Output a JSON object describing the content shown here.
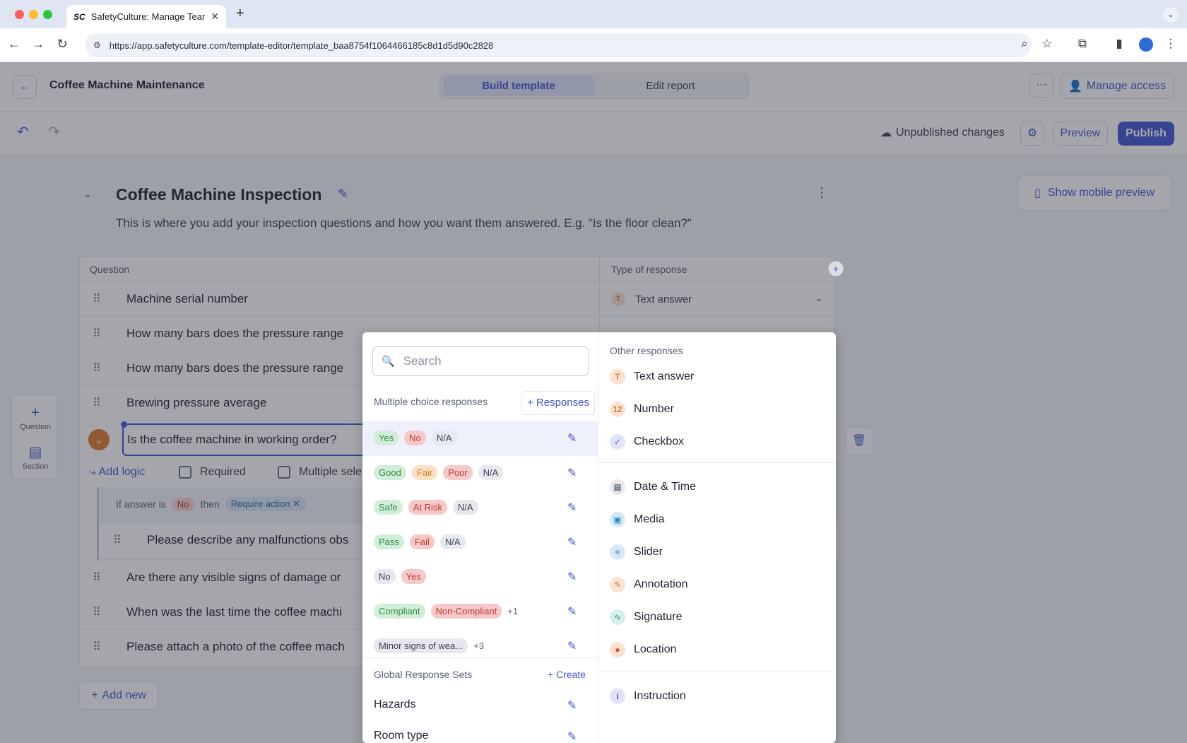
{
  "browser": {
    "tab_title": "SafetyCulture: Manage Teams and...",
    "favicon": "SC",
    "url": "https://app.safetyculture.com/template-editor/template_baa8754f1064466185c8d1d5d90c2828"
  },
  "header": {
    "title": "Coffee Machine Maintenance",
    "mode_build": "Build template",
    "mode_edit": "Edit report",
    "manage_access": "Manage access"
  },
  "toolbar": {
    "status": "Unpublished changes",
    "preview": "Preview",
    "publish": "Publish"
  },
  "mobile_preview": "Show mobile preview",
  "page": {
    "title": "Coffee Machine Inspection",
    "description": "This is where you add your inspection questions and how you want them answered. E.g. “Is the floor clean?”"
  },
  "table": {
    "col_question": "Question",
    "col_type": "Type of response",
    "first_type": "Text answer",
    "questions": [
      "Machine serial number",
      "How many bars does the pressure range",
      "How many bars does the pressure range",
      "Brewing pressure average"
    ],
    "active_question": "Is the coffee machine in working order?",
    "add_logic": "Add logic",
    "required": "Required",
    "multiple": "Multiple sele",
    "logic": {
      "if_answer_is": "If answer is",
      "answer": "No",
      "then": "then",
      "action": "Require action",
      "nested_question": "Please describe any malfunctions obs"
    },
    "more_questions": [
      "Are there any visible signs of damage or",
      "When was the last time the coffee machi",
      "Please attach a photo of the coffee mach"
    ],
    "add_new": "Add new"
  },
  "side_tools": {
    "question": "Question",
    "section": "Section"
  },
  "dropdown": {
    "search_placeholder": "Search",
    "mc_label": "Multiple choice responses",
    "responses_button": "+ Responses",
    "mc_sets": [
      {
        "chips": [
          {
            "t": "Yes",
            "c": "green"
          },
          {
            "t": "No",
            "c": "red"
          },
          {
            "t": "N/A",
            "c": "grey"
          }
        ]
      },
      {
        "chips": [
          {
            "t": "Good",
            "c": "green"
          },
          {
            "t": "Fair",
            "c": "orange"
          },
          {
            "t": "Poor",
            "c": "red"
          },
          {
            "t": "N/A",
            "c": "grey"
          }
        ]
      },
      {
        "chips": [
          {
            "t": "Safe",
            "c": "green"
          },
          {
            "t": "At Risk",
            "c": "red"
          },
          {
            "t": "N/A",
            "c": "grey"
          }
        ]
      },
      {
        "chips": [
          {
            "t": "Pass",
            "c": "green"
          },
          {
            "t": "Fail",
            "c": "red"
          },
          {
            "t": "N/A",
            "c": "grey"
          }
        ]
      },
      {
        "chips": [
          {
            "t": "No",
            "c": "grey"
          },
          {
            "t": "Yes",
            "c": "red"
          }
        ]
      },
      {
        "chips": [
          {
            "t": "Compliant",
            "c": "green"
          },
          {
            "t": "Non-Compliant",
            "c": "red"
          }
        ],
        "more": "+1"
      },
      {
        "chips": [
          {
            "t": "Minor signs of wea...",
            "c": "grey"
          }
        ],
        "more": "+3"
      }
    ],
    "grs_label": "Global Response Sets",
    "grs_create": "+ Create",
    "grs_items": [
      "Hazards",
      "Room type"
    ],
    "other_label": "Other responses",
    "types": [
      {
        "name": "Text answer",
        "icon": "T"
      },
      {
        "name": "Number",
        "icon": "12"
      },
      {
        "name": "Checkbox",
        "icon": "✓"
      },
      {
        "name": "Date & Time",
        "icon": "▦"
      },
      {
        "name": "Media",
        "icon": "▣"
      },
      {
        "name": "Slider",
        "icon": "≡"
      },
      {
        "name": "Annotation",
        "icon": "✎"
      },
      {
        "name": "Signature",
        "icon": "∿"
      },
      {
        "name": "Location",
        "icon": "●"
      },
      {
        "name": "Instruction",
        "icon": "i"
      }
    ]
  },
  "colors": {
    "accent": "#4256d3",
    "question_badge": "#e07a35"
  }
}
